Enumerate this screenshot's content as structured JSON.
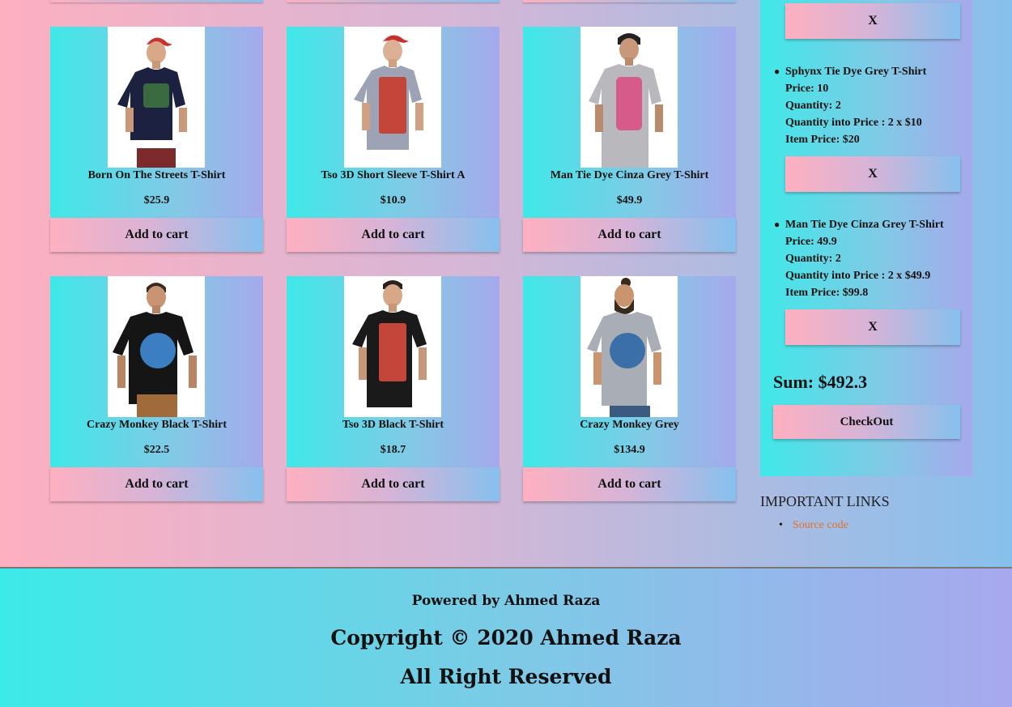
{
  "products": [
    {
      "name": "Born On The Streets T-Shirt",
      "price": "$25.9",
      "button": "Add to cart",
      "shirt_color": "#1d2140",
      "print_color": "#3a6a3f"
    },
    {
      "name": "Tso 3D Short Sleeve T-Shirt A",
      "price": "$10.9",
      "button": "Add to cart",
      "shirt_color": "#9da3b4",
      "print_color": "#c4453a"
    },
    {
      "name": "Man Tie Dye Cinza Grey T-Shirt",
      "price": "$49.9",
      "button": "Add to cart",
      "shirt_color": "#b9b9bd",
      "print_color": "#d65a8a"
    },
    {
      "name": "Crazy Monkey Black T-Shirt",
      "price": "$22.5",
      "button": "Add to cart",
      "shirt_color": "#151515",
      "print_color": "#3b7fc2"
    },
    {
      "name": "Tso 3D Black T-Shirt",
      "price": "$18.7",
      "button": "Add to cart",
      "shirt_color": "#1a1a1a",
      "print_color": "#c4453a"
    },
    {
      "name": "Crazy Monkey Grey",
      "price": "$134.9",
      "button": "Add to cart",
      "shirt_color": "#a9adb6",
      "print_color": "#3b6fa8"
    }
  ],
  "cart": {
    "remove_label": "X",
    "items": [
      {
        "name": "Sphynx Tie Dye Grey T-Shirt",
        "price": "Price: 10",
        "quantity": "Quantity: 2",
        "qty_price": "Quantity into Price : 2 x $10",
        "item_price": "Item Price: $20"
      },
      {
        "name": "Man Tie Dye Cinza Grey T-Shirt",
        "price": "Price: 49.9",
        "quantity": "Quantity: 2",
        "qty_price": "Quantity into Price : 2 x $49.9",
        "item_price": "Item Price: $99.8"
      }
    ],
    "sum": "Sum: $492.3",
    "checkout": "CheckOut"
  },
  "links": {
    "title": "IMPORTANT LINKS",
    "items": [
      "Source code"
    ]
  },
  "footer": {
    "powered": "Powered by Ahmed Raza",
    "copyright": "Copyright © 2020 Ahmed Raza",
    "rights": "All Right Reserved"
  }
}
